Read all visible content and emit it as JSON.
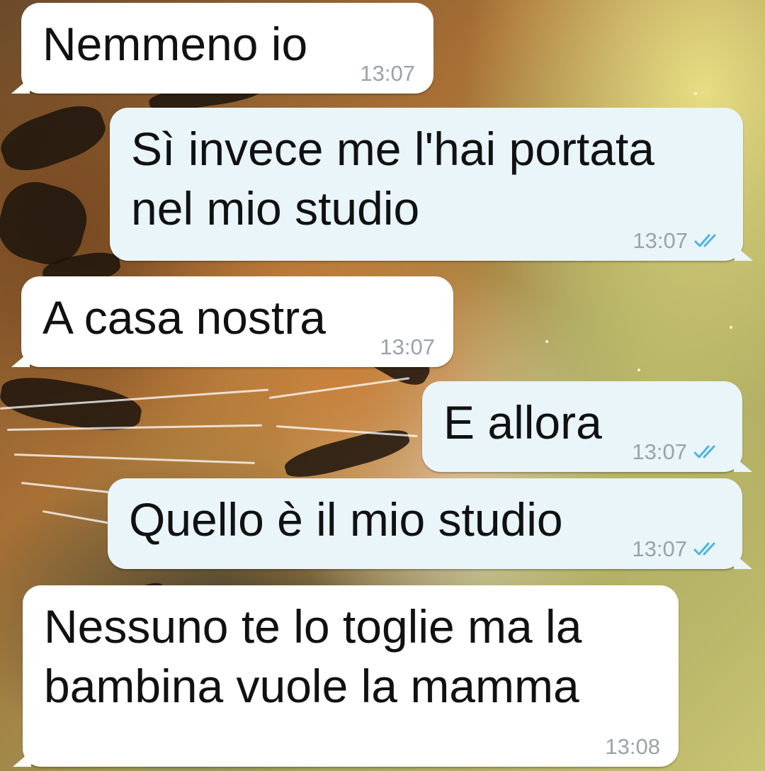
{
  "conversation": {
    "messages": [
      {
        "direction": "incoming",
        "text": "Nemmeno io",
        "time": "13:07"
      },
      {
        "direction": "outgoing",
        "text": "Sì invece me l'hai portata nel mio studio",
        "time": "13:07",
        "status": "read-double-check-icon",
        "status_color": "#4fb3e0"
      },
      {
        "direction": "incoming",
        "text": "A casa nostra",
        "time": "13:07"
      },
      {
        "direction": "outgoing",
        "text": "E allora",
        "time": "13:07",
        "status": "read-double-check-icon",
        "status_color": "#4fb3e0"
      },
      {
        "direction": "outgoing",
        "text": "Quello è il mio studio",
        "time": "13:07",
        "status": "read-double-check-icon",
        "status_color": "#4fb3e0"
      },
      {
        "direction": "incoming",
        "text": "Nessuno te lo toglie ma la bambina vuole la mamma",
        "time": "13:08"
      }
    ]
  },
  "theme": {
    "incoming_bubble": "#ffffff",
    "outgoing_bubble": "#e9f5f9",
    "timestamp_color": "#9aa3a6",
    "wallpaper": "tiger-illustration"
  }
}
